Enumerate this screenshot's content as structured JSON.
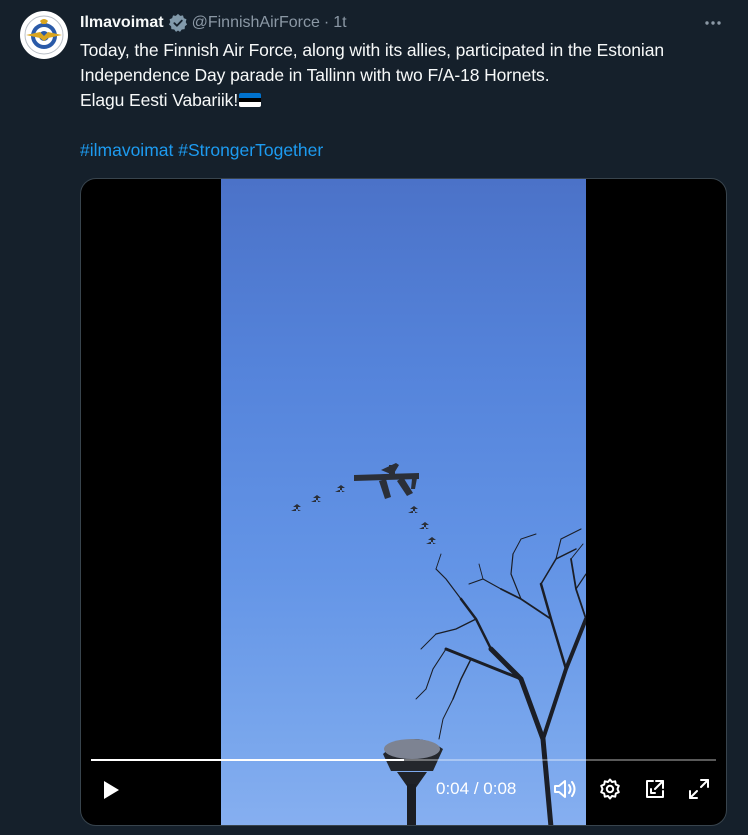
{
  "tweet": {
    "author_name": "Ilmavoimat",
    "handle": "@FinnishAirForce",
    "separator": "·",
    "time": "1t",
    "text": "Today, the Finnish Air Force, along with its allies, participated in the Estonian Independence Day parade in Tallinn with two F/A-18 Hornets.\nElagu Eesti Vabariik!",
    "flag_colors": [
      "#0072ce",
      "#000000",
      "#ffffff"
    ],
    "hashtags": [
      "#ilmavoimat",
      "#StrongerTogether"
    ],
    "accent_color": "#1d9bf0"
  },
  "video": {
    "current_time": "0:04",
    "time_separator": " / ",
    "duration": "0:08",
    "progress": 0.5,
    "icons": {
      "play": "play-icon",
      "volume": "volume-icon",
      "settings": "settings-icon",
      "pip": "picture-in-picture-icon",
      "fullscreen": "fullscreen-icon"
    }
  },
  "icons": {
    "verified": "verified-badge-icon",
    "more": "more-options-icon",
    "avatar": "air-force-emblem-avatar"
  }
}
